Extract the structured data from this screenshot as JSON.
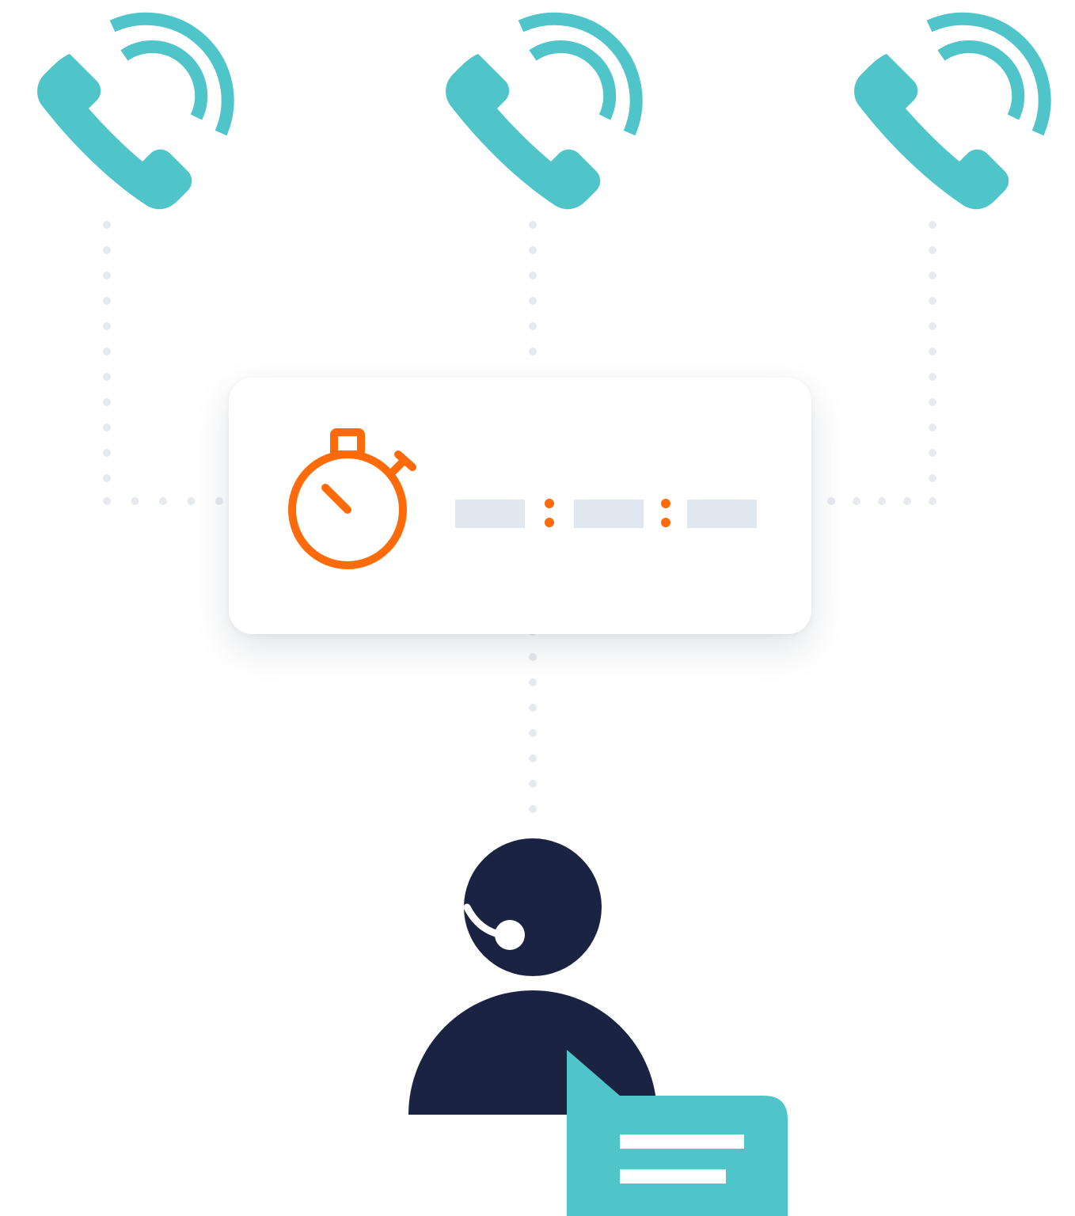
{
  "colors": {
    "accent_teal": "#4FC4C9",
    "timer_orange": "#FF6A0A",
    "agent_navy": "#1A2341",
    "connector_dots": "#E6EAEE",
    "placeholder_bar": "#E1E7EE",
    "background": "#FFFFFF"
  },
  "icons": {
    "incoming_calls": [
      "phone-ringing-icon",
      "phone-ringing-icon",
      "phone-ringing-icon"
    ],
    "timer": "stopwatch-icon",
    "agent": "headset-agent-icon",
    "message": "chat-bubble-icon"
  },
  "timer_display": {
    "segments": 3,
    "separator": "colon-dots"
  }
}
